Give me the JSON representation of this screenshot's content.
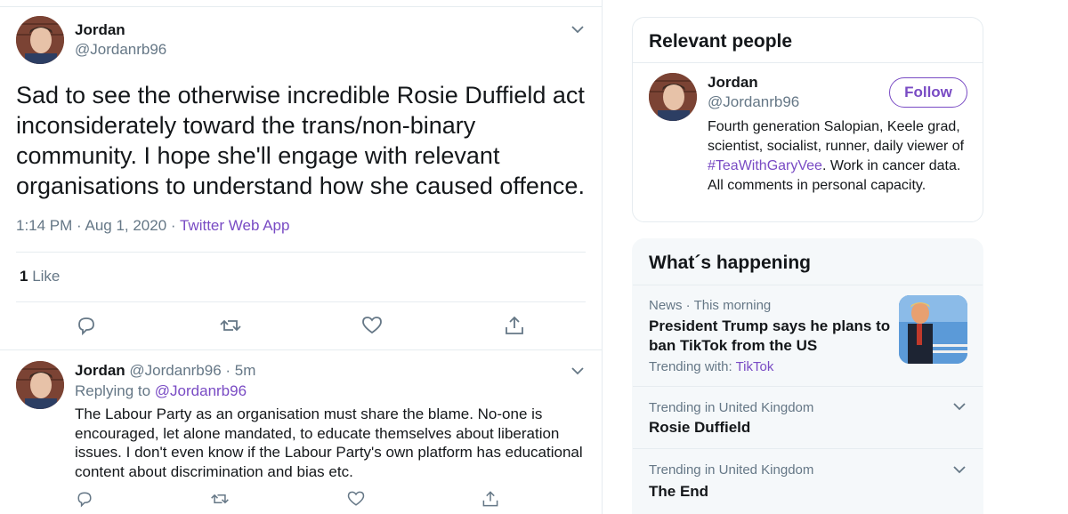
{
  "tweet": {
    "name": "Jordan",
    "handle": "@Jordanrb96",
    "text": "Sad to see the otherwise incredible Rosie Duffield act inconsiderately toward the trans/non-binary community. I hope she'll engage with relevant organisations to understand how she caused offence.",
    "time": "1:14 PM · Aug 1, 2020 · ",
    "app": "Twitter Web App",
    "like_count": "1",
    "like_label": " Like"
  },
  "reply": {
    "name": "Jordan",
    "handle_time": " @Jordanrb96 · 5m",
    "replying_label": "Replying to ",
    "replying_to": "@Jordanrb96",
    "text": "The Labour Party as an organisation must share the blame. No-one is encouraged, let alone mandated, to educate themselves about liberation issues. I don't even know if the Labour Party's own platform has educational content about discrimination and bias etc."
  },
  "relevant_people": {
    "title": "Relevant people",
    "name": "Jordan",
    "handle": "@Jordanrb96",
    "follow_label": "Follow",
    "bio_pre": "Fourth generation Salopian, Keele grad, scientist, socialist, runner, daily viewer of ",
    "bio_tag": "#TeaWithGaryVee",
    "bio_post": ". Work in cancer data. All comments in personal capacity."
  },
  "whats_happening": {
    "title": "What´s happening",
    "items": [
      {
        "context": "News · This morning",
        "title": "President Trump says he plans to ban TikTok from the US",
        "trending_label": "Trending with: ",
        "trending_link": "TikTok"
      },
      {
        "context": "Trending in United Kingdom",
        "title": "Rosie Duffield"
      },
      {
        "context": "Trending in United Kingdom",
        "title": "The End"
      }
    ]
  },
  "colors": {
    "accent": "#794bc4",
    "text": "#14171a",
    "secondary": "#657786",
    "border": "#e6ecf0"
  },
  "icons": [
    "chevron-down-icon",
    "reply-icon",
    "retweet-icon",
    "like-icon",
    "share-icon"
  ]
}
